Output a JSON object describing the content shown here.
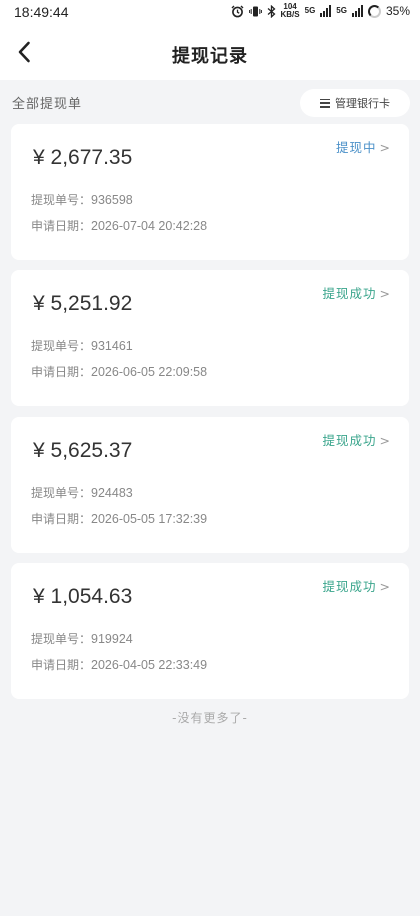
{
  "status_bar": {
    "time": "18:49:44",
    "net_speed_value": "104",
    "net_speed_unit": "KB/S",
    "network_1": "5G",
    "network_2": "5G",
    "battery": "35%"
  },
  "nav": {
    "title": "提现记录"
  },
  "filter": {
    "label": "全部提现单",
    "manage_bank_card": "管理银行卡"
  },
  "labels": {
    "order_no": "提现单号：",
    "apply_date": "申请日期："
  },
  "records": [
    {
      "amount": "¥ 2,677.35",
      "status": "提现中",
      "order_no": "936598",
      "date": "2026-07-04 20:42:28"
    },
    {
      "amount": "¥ 5,251.92",
      "status": "提现成功",
      "order_no": "931461",
      "date": "2026-06-05 22:09:58"
    },
    {
      "amount": "¥ 5,625.37",
      "status": "提现成功",
      "order_no": "924483",
      "date": "2026-05-05 17:32:39"
    },
    {
      "amount": "¥ 1,054.63",
      "status": "提现成功",
      "order_no": "919924",
      "date": "2026-04-05 22:33:49"
    }
  ],
  "status_arrow": ">",
  "footer": {
    "end_text": "-没有更多了-"
  },
  "colors": {
    "status_pending": "#4a90c8",
    "status_success": "#3aa58c",
    "background": "#f3f4f6"
  }
}
